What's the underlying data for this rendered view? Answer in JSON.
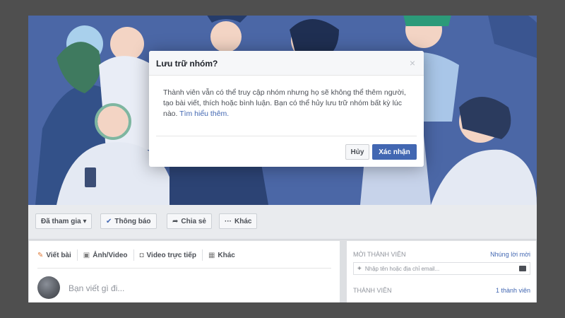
{
  "modal": {
    "title": "Lưu trữ nhóm?",
    "close_glyph": "×",
    "body_text": "Thành viên vẫn có thể truy cập nhóm nhưng họ sẽ không thể thêm người, tạo bài viết, thích hoặc bình luận. Bạn có thể hủy lưu trữ nhóm bất kỳ lúc nào.",
    "learn_more_link": "Tìm hiểu thêm.",
    "cancel_label": "Hủy",
    "confirm_label": "Xác nhận"
  },
  "action_bar": {
    "joined_label": "Đã tham gia ▾",
    "notifications_label": "Thông báo",
    "share_label": "Chia sẻ",
    "more_label": "Khác",
    "icons": {
      "notifications": "check-icon",
      "share": "share-arrow-icon",
      "more": "ellipsis-icon"
    }
  },
  "composer": {
    "tabs": [
      {
        "label": "Viết bài",
        "icon": "pencil-icon"
      },
      {
        "label": "Ảnh/Video",
        "icon": "photo-icon"
      },
      {
        "label": "Video trực tiếp",
        "icon": "live-video-icon"
      },
      {
        "label": "Khác",
        "icon": "more-grid-icon"
      }
    ],
    "placeholder": "Bạn viết gì đi..."
  },
  "side_panel": {
    "invite_heading": "MỜI THÀNH VIÊN",
    "invite_link": "Nhúng lời mời",
    "invite_input_placeholder": "Nhập tên hoặc địa chỉ email...",
    "members_heading": "THÀNH VIÊN",
    "members_count": "1 thành viên"
  },
  "colors": {
    "brand_blue": "#4267b2",
    "cover_bg": "#4b67a6",
    "page_bg": "#4f4f4f"
  }
}
